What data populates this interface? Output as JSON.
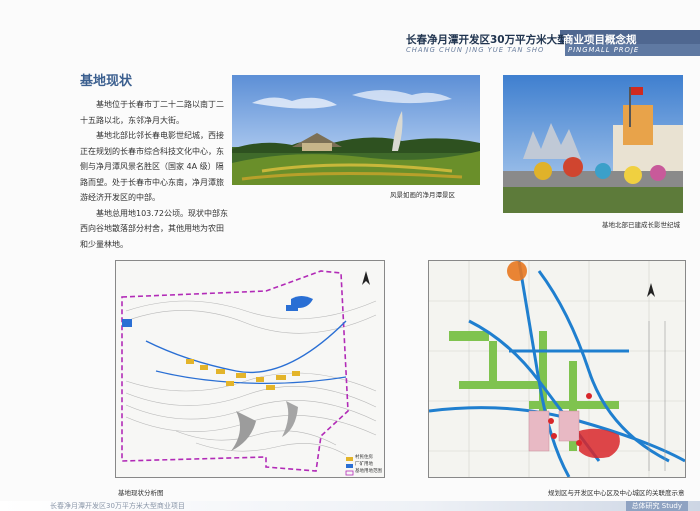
{
  "header": {
    "title": "长春净月潭开发区30万平方米大型",
    "title_highlight": "商业项目概念规",
    "subtitle": "CHANG CHUN JING YUE TAN SHO",
    "subtitle_highlight": "PINGMALL PROJE"
  },
  "section": {
    "title": "基地现状",
    "paragraphs": [
      "基地位于长春市丁二十二路以南丁二十五路以北，东邻净月大街。",
      "基地北部比邻长春电影世纪城，西接正在规划的长春市综合科技文化中心，东侧与净月潭风景名胜区（国家 4A 级）隔路而望。处于长春市中心东南，净月潭旅游经济开发区的中部。",
      "基地总用地103.72公顷。现状中部东西向谷地散落部分村舍，其他用地为农田和少量林地。"
    ]
  },
  "captions": {
    "photo1": "风景如画的净月潭景区",
    "photo2": "基地北部已建成长影世纪城",
    "map1": "基地现状分析图",
    "map2": "规划区与开发区中心区及中心城区的关联度示意"
  },
  "legend": {
    "items": [
      "村民住房",
      "厂矿用地",
      "基地用地范围"
    ]
  },
  "footer": {
    "left": "长春净月潭开发区30万平方米大型商业项目",
    "right": "总体研究 Study"
  },
  "colors": {
    "accent": "#4f6790",
    "title_blue": "#3b5f8f"
  }
}
